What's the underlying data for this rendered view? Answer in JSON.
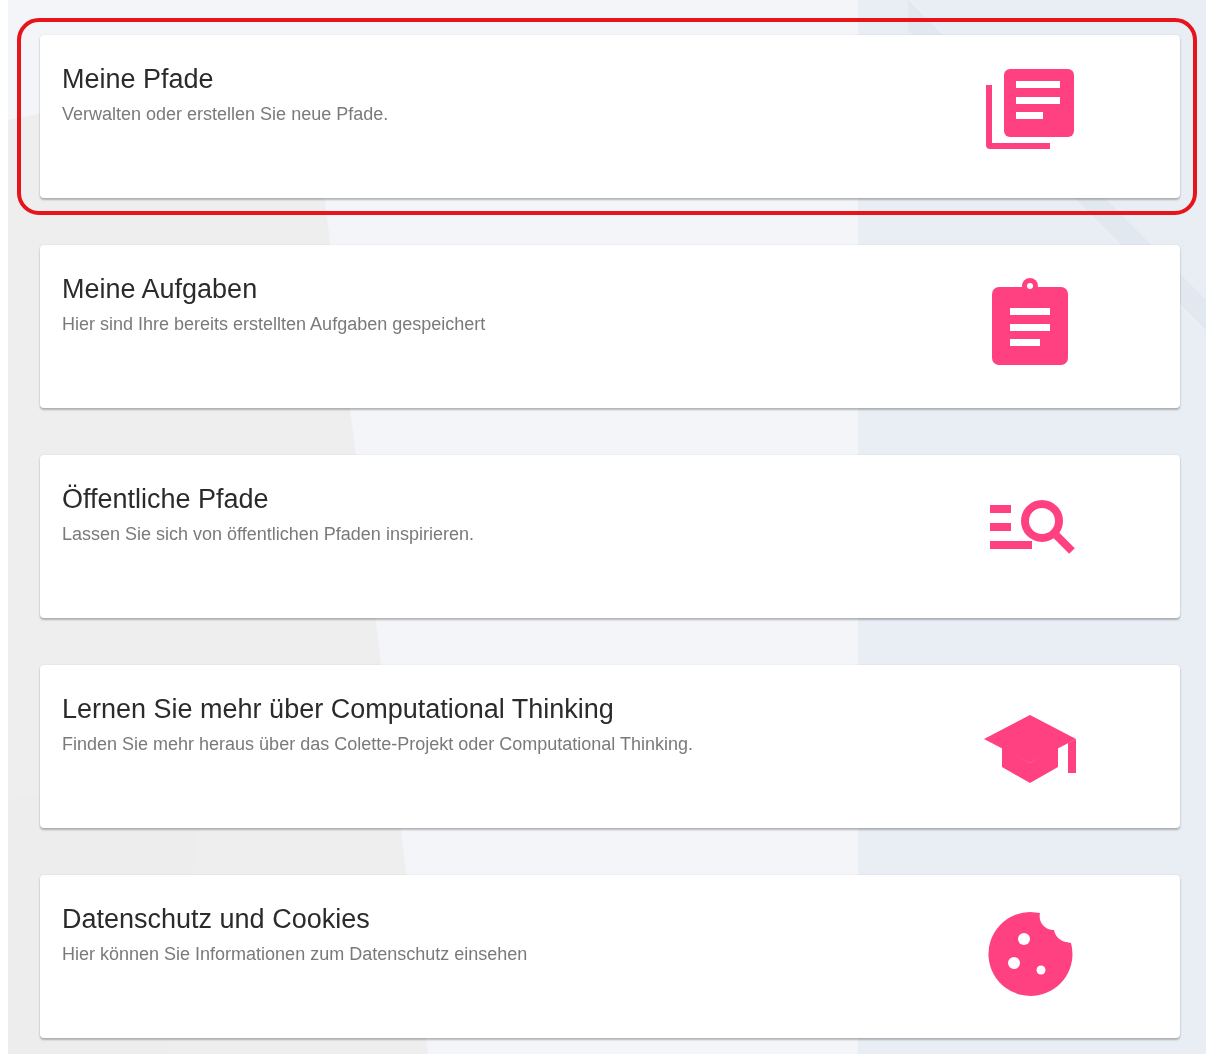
{
  "cards": [
    {
      "kind": "paths",
      "title": "Meine Pfade",
      "subtitle": "Verwalten oder erstellen Sie neue Pfade.",
      "highlighted": true
    },
    {
      "kind": "tasks",
      "title": "Meine Aufgaben",
      "subtitle": "Hier sind Ihre bereits erstellten Aufgaben gespeichert",
      "highlighted": false
    },
    {
      "kind": "public",
      "title": "Öffentliche Pfade",
      "subtitle": "Lassen Sie sich von öffentlichen Pfaden inspirieren.",
      "highlighted": false
    },
    {
      "kind": "learn",
      "title": "Lernen Sie mehr über Computational Thinking",
      "subtitle": "Finden Sie mehr heraus über das Colette-Projekt oder Computational Thinking.",
      "highlighted": false
    },
    {
      "kind": "privacy",
      "title": "Datenschutz und Cookies",
      "subtitle": "Hier können Sie Informationen zum Datenschutz einsehen",
      "highlighted": false
    }
  ]
}
